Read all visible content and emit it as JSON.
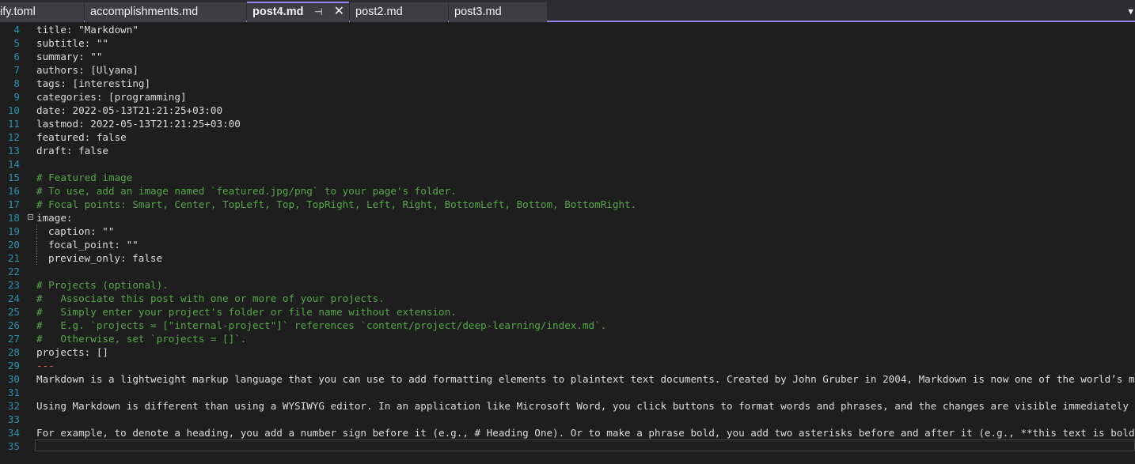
{
  "tabs": [
    {
      "label": "ify.toml"
    },
    {
      "label": "accomplishments.md"
    },
    {
      "label": "post4.md",
      "active": true
    },
    {
      "label": "post2.md"
    },
    {
      "label": "post3.md"
    }
  ],
  "lines": [
    {
      "n": "4",
      "text": "title: \"Markdown\"",
      "kind": "plain"
    },
    {
      "n": "5",
      "text": "subtitle: \"\"",
      "kind": "plain"
    },
    {
      "n": "6",
      "text": "summary: \"\"",
      "kind": "plain"
    },
    {
      "n": "7",
      "text": "authors: [Ulyana]",
      "kind": "plain"
    },
    {
      "n": "8",
      "text": "tags: [interesting]",
      "kind": "plain"
    },
    {
      "n": "9",
      "text": "categories: [programming]",
      "kind": "plain"
    },
    {
      "n": "10",
      "text": "date: 2022-05-13T21:21:25+03:00",
      "kind": "plain"
    },
    {
      "n": "11",
      "text": "lastmod: 2022-05-13T21:21:25+03:00",
      "kind": "plain"
    },
    {
      "n": "12",
      "text": "featured: false",
      "kind": "plain"
    },
    {
      "n": "13",
      "text": "draft: false",
      "kind": "plain"
    },
    {
      "n": "14",
      "text": "",
      "kind": "plain"
    },
    {
      "n": "15",
      "text": "# Featured image",
      "kind": "comment"
    },
    {
      "n": "16",
      "text": "# To use, add an image named `featured.jpg/png` to your page's folder.",
      "kind": "comment"
    },
    {
      "n": "17",
      "text": "# Focal points: Smart, Center, TopLeft, Top, TopRight, Left, Right, BottomLeft, Bottom, BottomRight.",
      "kind": "comment"
    },
    {
      "n": "18",
      "text": "image:",
      "kind": "plain",
      "fold": true
    },
    {
      "n": "19",
      "text": "caption: \"\"",
      "kind": "plain",
      "indent": true
    },
    {
      "n": "20",
      "text": "focal_point: \"\"",
      "kind": "plain",
      "indent": true
    },
    {
      "n": "21",
      "text": "preview_only: false",
      "kind": "plain",
      "indent": true
    },
    {
      "n": "22",
      "text": "",
      "kind": "plain"
    },
    {
      "n": "23",
      "text": "# Projects (optional).",
      "kind": "comment"
    },
    {
      "n": "24",
      "text": "#   Associate this post with one or more of your projects.",
      "kind": "comment"
    },
    {
      "n": "25",
      "text": "#   Simply enter your project's folder or file name without extension.",
      "kind": "comment"
    },
    {
      "n": "26",
      "text": "#   E.g. `projects = [\"internal-project\"]` references `content/project/deep-learning/index.md`.",
      "kind": "comment"
    },
    {
      "n": "27",
      "text": "#   Otherwise, set `projects = []`.",
      "kind": "comment"
    },
    {
      "n": "28",
      "text": "projects: []",
      "kind": "plain"
    },
    {
      "n": "29",
      "text": "---",
      "kind": "fence"
    },
    {
      "n": "30",
      "text": "Markdown is a lightweight markup language that you can use to add formatting elements to plaintext text documents. Created by John Gruber in 2004, Markdown is now one of the world’s m",
      "kind": "plain"
    },
    {
      "n": "31",
      "text": "",
      "kind": "plain"
    },
    {
      "n": "32",
      "text": "Using Markdown is different than using a WYSIWYG editor. In an application like Microsoft Word, you click buttons to format words and phrases, and the changes are visible immediately",
      "kind": "plain"
    },
    {
      "n": "33",
      "text": "",
      "kind": "plain"
    },
    {
      "n": "34",
      "text": "For example, to denote a heading, you add a number sign before it (e.g., # Heading One). Or to make a phrase bold, you add two asterisks before and after it (e.g., **this text is bold",
      "kind": "plain"
    },
    {
      "n": "35",
      "text": "",
      "kind": "plain",
      "cursor": true
    }
  ],
  "colors": {
    "background": "#1e1e1e",
    "line_number": "#2b91af",
    "comment": "#57a64a",
    "text": "#dcdcdc",
    "fence": "#e4635d",
    "accent": "#9184ee"
  }
}
